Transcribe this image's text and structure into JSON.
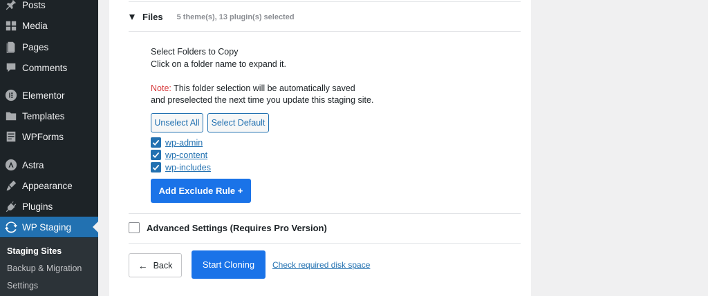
{
  "sidebar": {
    "items": [
      {
        "label": "Posts",
        "icon": "pin-icon"
      },
      {
        "label": "Media",
        "icon": "media-icon"
      },
      {
        "label": "Pages",
        "icon": "pages-icon"
      },
      {
        "label": "Comments",
        "icon": "comments-icon"
      },
      {
        "label": "Elementor",
        "icon": "elementor-icon"
      },
      {
        "label": "Templates",
        "icon": "folder-icon"
      },
      {
        "label": "WPForms",
        "icon": "wpforms-icon"
      },
      {
        "label": "Astra",
        "icon": "astra-icon"
      },
      {
        "label": "Appearance",
        "icon": "paintbrush-icon"
      },
      {
        "label": "Plugins",
        "icon": "plugin-icon"
      },
      {
        "label": "WP Staging",
        "icon": "sync-icon"
      }
    ],
    "submenu": [
      "Staging Sites",
      "Backup & Migration",
      "Settings"
    ]
  },
  "files": {
    "title": "Files",
    "summary": "5 theme(s), 13 plugin(s) selected"
  },
  "folders": {
    "heading": "Select Folders to Copy",
    "hint": "Click on a folder name to expand it.",
    "note_label": "Note:",
    "note_text_1": " This folder selection will be automatically saved",
    "note_text_2": "and preselected the next time you update this staging site.",
    "unselect_all": "Unselect All",
    "select_default": "Select Default",
    "items": [
      "wp-admin",
      "wp-content",
      "wp-includes"
    ],
    "add_exclude_rule": "Add Exclude Rule +"
  },
  "advanced": {
    "label": "Advanced Settings (Requires Pro Version)"
  },
  "actions": {
    "back": "Back",
    "start_cloning": "Start Cloning",
    "check_disk": "Check required disk space"
  },
  "colors": {
    "sidebar_bg": "#1d2327",
    "accent": "#2271b1",
    "primary_button": "#1a73e8",
    "note_red": "#d63638"
  }
}
